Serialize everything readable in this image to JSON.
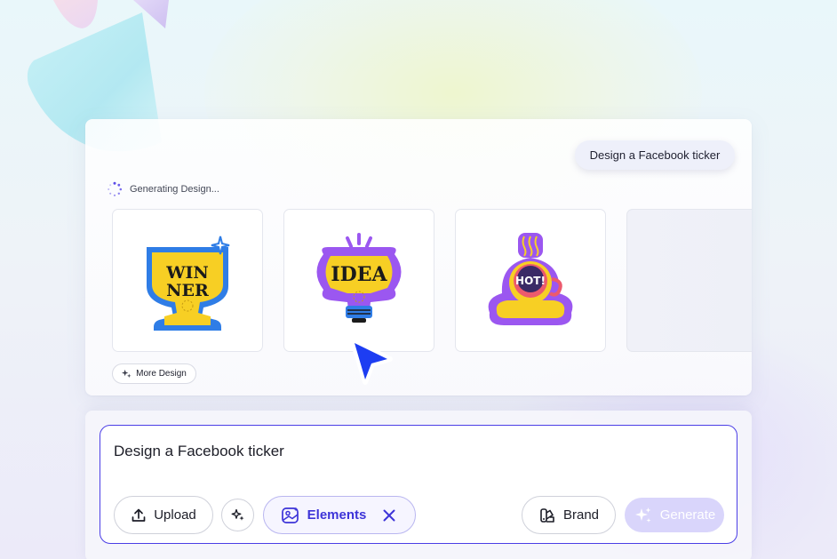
{
  "generation_card": {
    "prompt_chip": "Design a Facebook ticker",
    "status_text": "Generating Design...",
    "more_button_label": "More Design",
    "sticker_texts": {
      "winner_line1": "WIN",
      "winner_line2": "NER",
      "idea": "IDEA",
      "hot": "HOT!"
    }
  },
  "prompt_panel": {
    "input_value": "Design a Facebook ticker",
    "upload_label": "Upload",
    "elements_label": "Elements",
    "brand_label": "Brand",
    "generate_label": "Generate"
  },
  "icons": {
    "spinner": "loading-spinner-icon",
    "sparkle": "sparkle-icon",
    "upload": "upload-icon",
    "elements": "image-elements-icon",
    "close": "close-icon",
    "brand": "brand-palette-icon",
    "cursor": "pointer-cursor-icon"
  },
  "colors": {
    "accent": "#4b3ee6",
    "generate_disabled": "#d9d5fb",
    "sticker_yellow": "#f7cf24",
    "sticker_blue": "#2f7de6",
    "sticker_purple": "#9b57f0",
    "cursor_blue": "#1d3df2"
  }
}
